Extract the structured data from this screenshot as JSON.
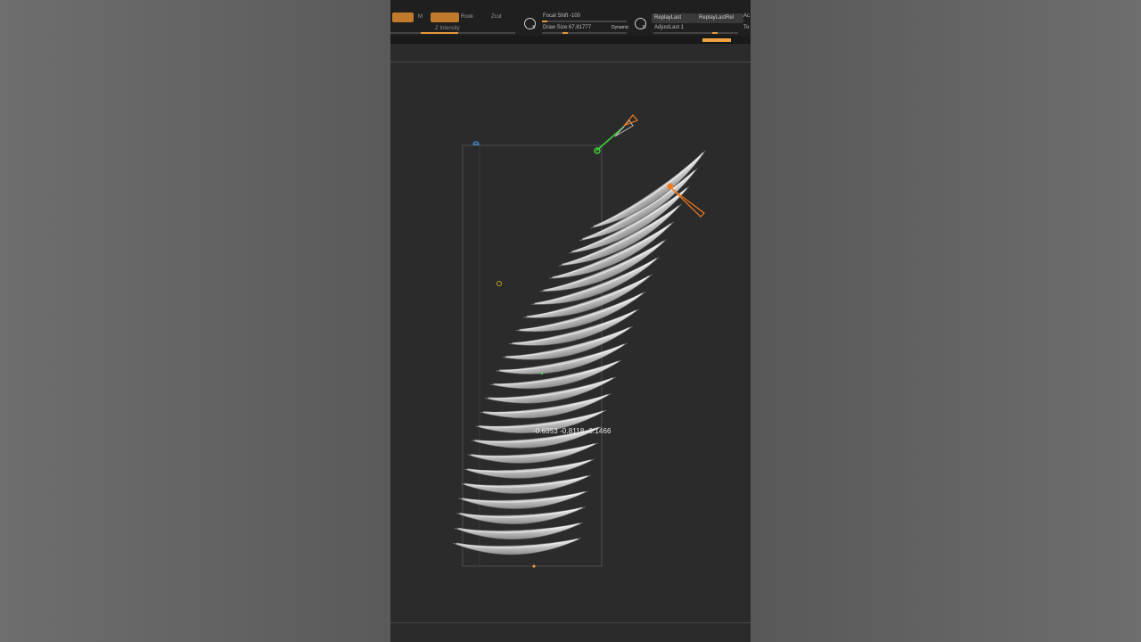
{
  "toolbar": {
    "mode_buttons": [
      "",
      "M",
      "",
      "Rook",
      "Zcut"
    ],
    "z_intensity_label": "Z Intensity",
    "focal_shift_label": "Focal Shift -100",
    "draw_size_label": "Draw Size 67.81777",
    "dynamic_label": "Dynamic",
    "brush_s_label": "S",
    "brush_d_label": "D",
    "replay_last_label": "ReplayLast",
    "replay_last_rel_label": "ReplayLastRel",
    "adjust_last_label": "AdjustLast 1",
    "edge_a_label": "Ac",
    "edge_t_label": "To",
    "accent_color": "#e39a3a"
  },
  "viewport": {
    "coordinate_readout": "-0.6353 -0.8118 -0.1466",
    "gizmo_colors": {
      "green": "#3fd13a",
      "orange": "#f07a1e",
      "blue": "#4a8fe0"
    },
    "mesh_color": "#d9d9d9"
  }
}
